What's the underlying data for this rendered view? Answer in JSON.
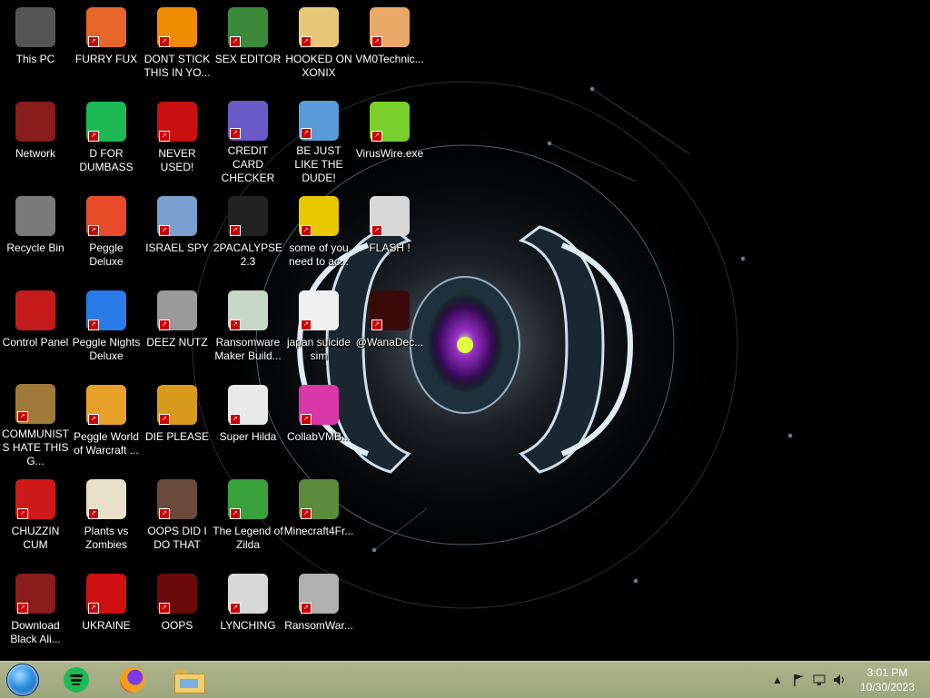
{
  "desktop": {
    "columns": [
      [
        {
          "label": "This PC",
          "icon": "computer-icon",
          "color": "#555555"
        },
        {
          "label": "Network",
          "icon": "network-icon",
          "color": "#8a1c1c"
        },
        {
          "label": "Recycle Bin",
          "icon": "recycle-bin-icon",
          "color": "#7a7a7a"
        },
        {
          "label": "Control Panel",
          "icon": "control-panel-icon",
          "color": "#c41a1a"
        },
        {
          "label": "COMMUNISTS HATE THIS G...",
          "icon": "money-bag-icon",
          "color": "#a07a3a"
        },
        {
          "label": "CHUZZIN CUM",
          "icon": "chuzzle-icon",
          "color": "#d01a1a"
        },
        {
          "label": "Download Black Ali...",
          "icon": "alien-icon",
          "color": "#8a1c1c"
        }
      ],
      [
        {
          "label": "FURRY FUX",
          "icon": "firefox-icon",
          "color": "#e8662a"
        },
        {
          "label": "D FOR DUMBASS",
          "icon": "spotify-icon",
          "color": "#1db954"
        },
        {
          "label": "Peggle Deluxe",
          "icon": "peggle-icon",
          "color": "#e84b2a"
        },
        {
          "label": "Peggle Nights Deluxe",
          "icon": "peggle-nights-icon",
          "color": "#2a7ae8"
        },
        {
          "label": "Peggle World of Warcraft ...",
          "icon": "peggle-wow-icon",
          "color": "#e8a02a"
        },
        {
          "label": "Plants vs Zombies",
          "icon": "flower-icon",
          "color": "#e8e0c8"
        },
        {
          "label": "UKRAINE",
          "icon": "radiation-icon",
          "color": "#d01010"
        }
      ],
      [
        {
          "label": "DONT STICK THIS IN YO...",
          "icon": "vlc-icon",
          "color": "#f08c00"
        },
        {
          "label": "NEVER USED!",
          "icon": "devcpp-icon",
          "color": "#c81010"
        },
        {
          "label": "ISRAEL SPY",
          "icon": "network-spy-icon",
          "color": "#7aa0d0"
        },
        {
          "label": "DEEZ NUTZ",
          "icon": "windows-stack-icon",
          "color": "#9a9a9a"
        },
        {
          "label": "DIE PLEASE",
          "icon": "de-icon",
          "color": "#d89a1a"
        },
        {
          "label": "OOPS DID I DO THAT",
          "icon": "portrait-icon",
          "color": "#6a4a3a"
        },
        {
          "label": "OOPS",
          "icon": "alien-red-icon",
          "color": "#6a0a0a"
        }
      ],
      [
        {
          "label": "SEX EDITOR",
          "icon": "editor-icon",
          "color": "#3a8a3a"
        },
        {
          "label": "CREDIT CARD CHECKER",
          "icon": "credit-card-icon",
          "color": "#6a5ac8"
        },
        {
          "label": "2PACALYPSE 2.3",
          "icon": "terminal-icon",
          "color": "#222222"
        },
        {
          "label": "Ransomware Maker Build...",
          "icon": "window-app-icon",
          "color": "#c8d8c8"
        },
        {
          "label": "Super Hilda",
          "icon": "pixel-dog-icon",
          "color": "#e8e8e8"
        },
        {
          "label": "The Legend of Zilda",
          "icon": "pixel-hero-icon",
          "color": "#3aa03a"
        },
        {
          "label": "LYNCHING",
          "icon": "emblem-icon",
          "color": "#d8d8d8"
        }
      ],
      [
        {
          "label": "HOOKED ON XONIX",
          "icon": "cartoon-icon",
          "color": "#e8c878"
        },
        {
          "label": "BE JUST LIKE THE DUDE!",
          "icon": "santa-icon",
          "color": "#5a9ad8"
        },
        {
          "label": "some of you need to ac...",
          "icon": "dog-icon",
          "color": "#e8c800"
        },
        {
          "label": "japan suicide sim",
          "icon": "document-icon",
          "color": "#f0f0f0"
        },
        {
          "label": "CollabVMB...",
          "icon": "monitor-icon",
          "color": "#d838a8"
        },
        {
          "label": "Minecraft4Fr...",
          "icon": "grass-block-icon",
          "color": "#5a8a3a"
        },
        {
          "label": "RansomWar...",
          "icon": "skull-icon",
          "color": "#b0b0b0"
        }
      ],
      [
        {
          "label": "VM0Technic...",
          "icon": "doctor-icon",
          "color": "#e8a868"
        },
        {
          "label": "VirusWire.exe",
          "icon": "lime-icon",
          "color": "#7ad02a"
        },
        {
          "label": "FLASH !",
          "icon": "flash-icon",
          "color": "#d8d8d8"
        },
        {
          "label": "@WanaDec...",
          "icon": "decryptor-icon",
          "color": "#3a0a0a"
        }
      ]
    ]
  },
  "taskbar": {
    "start_icon": "start-orb-icon",
    "pinned": [
      {
        "name": "spotify",
        "icon": "spotify-icon",
        "color": "#1db954"
      },
      {
        "name": "firefox",
        "icon": "firefox-icon",
        "color": "#e8662a"
      },
      {
        "name": "file-explorer",
        "icon": "folder-icon",
        "color": "#e8c86a"
      }
    ],
    "tray": {
      "time": "3:01 PM",
      "date": "10/30/2023",
      "chevron": "▲"
    }
  }
}
